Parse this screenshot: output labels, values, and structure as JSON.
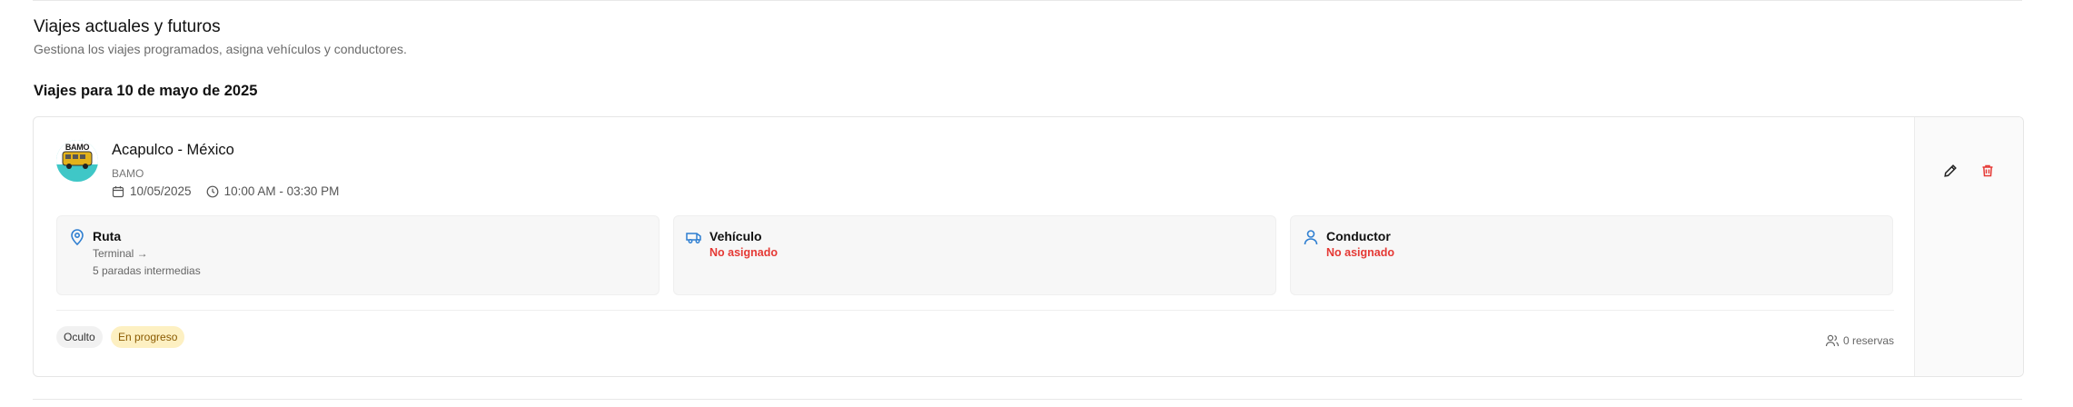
{
  "page": {
    "title": "Viajes actuales y futuros",
    "subtitle": "Gestiona los viajes programados, asigna vehículos y conductores.",
    "section_title": "Viajes para 10 de mayo de 2025"
  },
  "trip": {
    "logo_text": "BAMO",
    "route_name": "Acapulco - México",
    "company": "BAMO",
    "date": "10/05/2025",
    "time": "10:00 AM - 03:30 PM",
    "route": {
      "title": "Ruta",
      "origin": "Terminal →",
      "stops": "5 paradas intermedias",
      "icon": "map-pin-icon"
    },
    "vehicle": {
      "title": "Vehículo",
      "status": "No asignado",
      "icon": "bus-icon"
    },
    "driver": {
      "title": "Conductor",
      "status": "No asignado",
      "icon": "user-icon"
    },
    "badges": {
      "visibility": "Oculto",
      "status": "En progreso"
    },
    "reservations": "0 reservas"
  },
  "colors": {
    "accent_blue": "#2f7fd1",
    "alert_red": "#e53935",
    "badge_progress_bg": "#fdf0c2",
    "badge_progress_text": "#8a5a00"
  }
}
